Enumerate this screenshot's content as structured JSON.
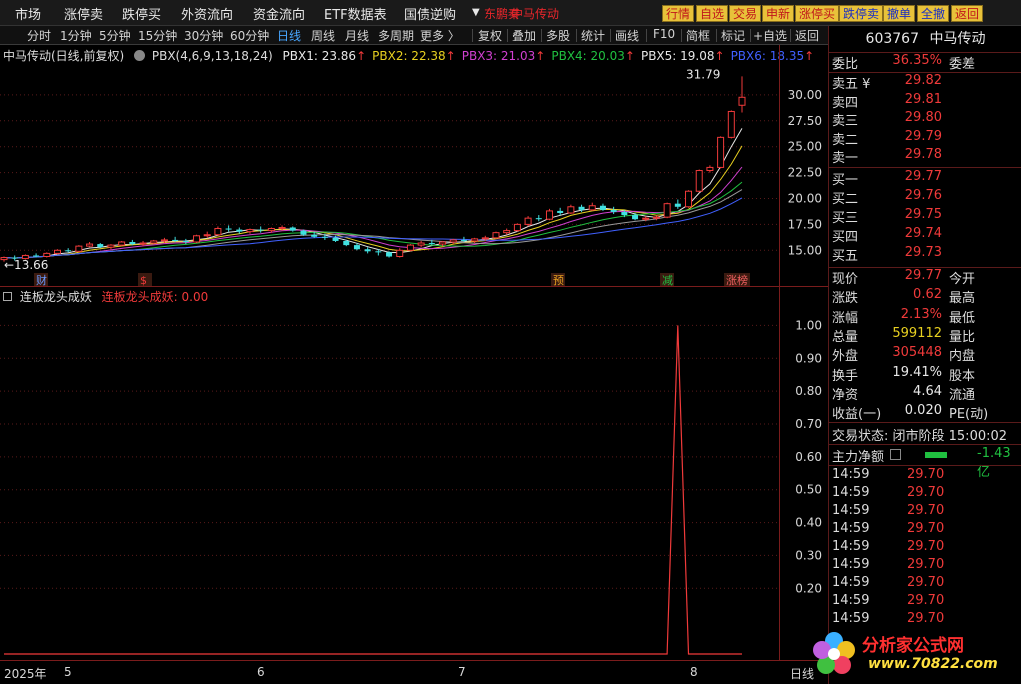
{
  "menu": {
    "items": [
      "市场",
      "涨停卖",
      "跌停买",
      "外资流向",
      "资金流向",
      "ETF数据表",
      "国债逆购"
    ],
    "dropdown_arrow": "▼",
    "red_items": [
      "东鹏秦",
      "中马传动"
    ],
    "quick_buttons": [
      "行情",
      "自选",
      "交易",
      "申新",
      "涨停买",
      "跌停卖",
      "撤单",
      "全撤",
      "返回"
    ]
  },
  "toolbar": {
    "periods": [
      "分时",
      "1分钟",
      "5分钟",
      "15分钟",
      "30分钟",
      "60分钟",
      "日线",
      "周线",
      "月线",
      "多周期",
      "更多 〉"
    ],
    "active_period": "日线",
    "actions": [
      "复权",
      "叠加",
      "多股",
      "统计",
      "画线",
      "F10",
      "简框",
      "标记",
      "+自选",
      "返回"
    ]
  },
  "main_indicator": {
    "stock": "中马传动(日线,前复权)",
    "formula": "PBX(4,6,9,13,18,24)",
    "pbx": [
      {
        "label": "PBX1: 23.86",
        "color": "#e8e8e8"
      },
      {
        "label": "PBX2: 22.38",
        "color": "#e8d020"
      },
      {
        "label": "PBX3: 21.03",
        "color": "#d040d0"
      },
      {
        "label": "PBX4: 20.03",
        "color": "#20c040"
      },
      {
        "label": "PBX5: 19.08",
        "color": "#e8e8e8"
      },
      {
        "label": "PBX6: 18.35",
        "color": "#4060ff"
      }
    ],
    "up_arrow": "↑",
    "high_label": "31.79",
    "low_label": "13.66",
    "event_tags": [
      "财",
      "$",
      "预",
      "减",
      "涨榜"
    ]
  },
  "sub_indicator": {
    "name": "连板龙头成妖",
    "value_text": "连板龙头成妖: 0.00"
  },
  "chart_data": [
    {
      "type": "candlestick",
      "title": "中马传动(日线,前复权)",
      "y_ticks": [
        30.0,
        27.5,
        25.0,
        22.5,
        20.0,
        17.5,
        15.0
      ],
      "ylim": [
        13.0,
        32.5
      ],
      "x_ticks": [
        "2025年",
        "5",
        "6",
        "7",
        "8"
      ],
      "candles": [
        [
          14.1,
          14.4,
          13.9,
          14.3
        ],
        [
          14.3,
          14.5,
          14.0,
          14.2
        ],
        [
          14.2,
          14.6,
          14.1,
          14.5
        ],
        [
          14.5,
          14.7,
          14.3,
          14.4
        ],
        [
          14.4,
          14.8,
          14.3,
          14.7
        ],
        [
          14.7,
          15.1,
          14.6,
          15.0
        ],
        [
          15.0,
          15.2,
          14.8,
          14.9
        ],
        [
          14.9,
          15.5,
          14.8,
          15.4
        ],
        [
          15.4,
          15.8,
          15.3,
          15.6
        ],
        [
          15.6,
          15.7,
          15.2,
          15.3
        ],
        [
          15.3,
          15.6,
          15.1,
          15.5
        ],
        [
          15.5,
          15.9,
          15.4,
          15.8
        ],
        [
          15.8,
          16.0,
          15.5,
          15.6
        ],
        [
          15.6,
          15.9,
          15.4,
          15.7
        ],
        [
          15.7,
          16.0,
          15.6,
          15.9
        ],
        [
          15.9,
          16.2,
          15.7,
          16.0
        ],
        [
          16.0,
          16.3,
          15.8,
          15.9
        ],
        [
          15.9,
          16.1,
          15.6,
          15.8
        ],
        [
          15.8,
          16.5,
          15.7,
          16.4
        ],
        [
          16.4,
          16.8,
          16.2,
          16.5
        ],
        [
          16.5,
          17.3,
          16.4,
          17.1
        ],
        [
          17.1,
          17.4,
          16.8,
          17.0
        ],
        [
          17.0,
          17.2,
          16.6,
          16.8
        ],
        [
          16.8,
          17.1,
          16.6,
          17.0
        ],
        [
          17.0,
          17.3,
          16.7,
          16.9
        ],
        [
          16.9,
          17.2,
          16.7,
          17.1
        ],
        [
          17.1,
          17.4,
          16.9,
          17.2
        ],
        [
          17.2,
          17.3,
          16.8,
          16.9
        ],
        [
          16.9,
          17.0,
          16.4,
          16.5
        ],
        [
          16.5,
          16.8,
          16.2,
          16.3
        ],
        [
          16.3,
          16.6,
          16.0,
          16.2
        ],
        [
          16.2,
          16.4,
          15.8,
          15.9
        ],
        [
          15.9,
          16.0,
          15.4,
          15.5
        ],
        [
          15.5,
          15.7,
          15.0,
          15.1
        ],
        [
          15.1,
          15.3,
          14.7,
          14.9
        ],
        [
          14.9,
          15.1,
          14.5,
          14.8
        ],
        [
          14.8,
          14.9,
          14.3,
          14.4
        ],
        [
          14.4,
          15.2,
          14.3,
          15.0
        ],
        [
          15.0,
          15.6,
          14.9,
          15.5
        ],
        [
          15.5,
          15.9,
          15.3,
          15.7
        ],
        [
          15.7,
          16.0,
          15.5,
          15.6
        ],
        [
          15.6,
          15.9,
          15.4,
          15.8
        ],
        [
          15.8,
          16.1,
          15.6,
          16.0
        ],
        [
          16.0,
          16.3,
          15.8,
          15.9
        ],
        [
          15.9,
          16.2,
          15.7,
          16.1
        ],
        [
          16.1,
          16.4,
          15.9,
          16.2
        ],
        [
          16.2,
          16.8,
          16.1,
          16.7
        ],
        [
          16.7,
          17.1,
          16.5,
          16.9
        ],
        [
          16.9,
          17.6,
          16.8,
          17.5
        ],
        [
          17.5,
          18.3,
          17.3,
          18.1
        ],
        [
          18.1,
          18.4,
          17.8,
          18.0
        ],
        [
          18.0,
          19.0,
          17.9,
          18.8
        ],
        [
          18.8,
          19.1,
          18.4,
          18.6
        ],
        [
          18.6,
          19.4,
          18.5,
          19.2
        ],
        [
          19.2,
          19.4,
          18.7,
          18.9
        ],
        [
          18.9,
          19.6,
          18.8,
          19.3
        ],
        [
          19.3,
          19.5,
          18.8,
          18.9
        ],
        [
          18.9,
          19.2,
          18.5,
          18.7
        ],
        [
          18.7,
          18.9,
          18.2,
          18.4
        ],
        [
          18.4,
          18.6,
          17.9,
          18.0
        ],
        [
          18.0,
          18.3,
          17.8,
          18.1
        ],
        [
          18.1,
          18.4,
          17.9,
          18.2
        ],
        [
          18.2,
          19.6,
          18.1,
          19.5
        ],
        [
          19.5,
          19.9,
          19.0,
          19.2
        ],
        [
          19.2,
          20.8,
          19.1,
          20.7
        ],
        [
          20.7,
          22.8,
          20.6,
          22.7
        ],
        [
          22.7,
          23.2,
          22.5,
          23.0
        ],
        [
          23.0,
          26.0,
          22.9,
          25.9
        ],
        [
          25.9,
          28.5,
          25.8,
          28.4
        ],
        [
          29.0,
          31.79,
          28.3,
          29.77
        ]
      ],
      "pbx_end_values": [
        23.86,
        22.38,
        21.03,
        20.03,
        19.08,
        18.35
      ]
    },
    {
      "type": "line",
      "title": "连板龙头成妖",
      "y_ticks": [
        1.0,
        0.9,
        0.8,
        0.7,
        0.6,
        0.5,
        0.4,
        0.3,
        0.2
      ],
      "ylim": [
        0,
        1.05
      ],
      "series": [
        {
          "name": "连板龙头成妖",
          "spike_index": 63,
          "values_note": "0 everywhere except spike to 1.00 at index 63"
        }
      ]
    }
  ],
  "right_panel": {
    "code": "603767",
    "name": "中马传动",
    "weibi_label": "委比",
    "weibi_value": "36.35%",
    "weicha_label": "委差",
    "asks": [
      {
        "label": "卖五 ¥",
        "price": "29.82"
      },
      {
        "label": "卖四",
        "price": "29.81"
      },
      {
        "label": "卖三",
        "price": "29.80"
      },
      {
        "label": "卖二",
        "price": "29.79"
      },
      {
        "label": "卖一",
        "price": "29.78"
      }
    ],
    "bids": [
      {
        "label": "买一",
        "price": "29.77"
      },
      {
        "label": "买二",
        "price": "29.76"
      },
      {
        "label": "买三",
        "price": "29.75"
      },
      {
        "label": "买四",
        "price": "29.74"
      },
      {
        "label": "买五",
        "price": "29.73"
      }
    ],
    "stats": [
      {
        "label": "现价",
        "value": "29.77",
        "color": "red",
        "label2": "今开"
      },
      {
        "label": "涨跌",
        "value": "0.62",
        "color": "red",
        "label2": "最高"
      },
      {
        "label": "涨幅",
        "value": "2.13%",
        "color": "red",
        "label2": "最低"
      },
      {
        "label": "总量",
        "value": "599112",
        "color": "yel",
        "label2": "量比"
      },
      {
        "label": "外盘",
        "value": "305448",
        "color": "red",
        "label2": "内盘"
      },
      {
        "label": "换手",
        "value": "19.41%",
        "color": "wht",
        "label2": "股本"
      },
      {
        "label": "净资",
        "value": "4.64",
        "color": "wht",
        "label2": "流通"
      },
      {
        "label": "收益(一)",
        "value": "0.020",
        "color": "wht",
        "label2": "PE(动)"
      }
    ],
    "trade_status": "交易状态: 闭市阶段 15:00:02",
    "main_net_label": "主力净额",
    "main_net_value": "-1.43亿",
    "ticks": [
      {
        "time": "14:59",
        "price": "29.70"
      },
      {
        "time": "14:59",
        "price": "29.70"
      },
      {
        "time": "14:59",
        "price": "29.70"
      },
      {
        "time": "14:59",
        "price": "29.70"
      },
      {
        "time": "14:59",
        "price": "29.70"
      },
      {
        "time": "14:59",
        "price": "29.70"
      },
      {
        "time": "14:59",
        "price": "29.70"
      },
      {
        "time": "14:59",
        "price": "29.70"
      },
      {
        "time": "14:59",
        "price": "29.70"
      }
    ]
  },
  "xaxis": {
    "labels": [
      "2025年",
      "5",
      "6",
      "7",
      "8"
    ],
    "right_label": "日线"
  },
  "watermark": {
    "line1": "分析家公式网",
    "line2": "www.70822.com"
  }
}
